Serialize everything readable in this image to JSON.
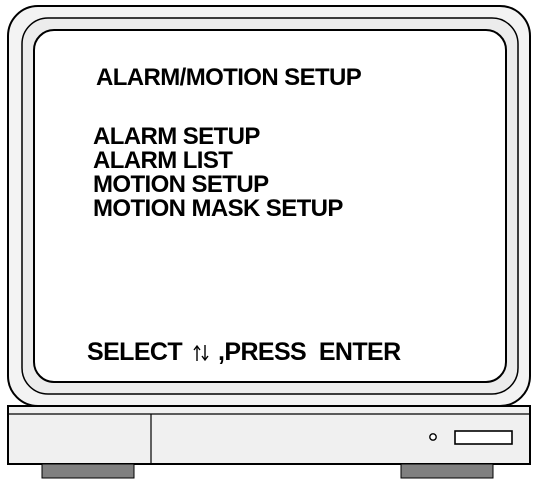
{
  "osd_menu": {
    "title": "ALARM/MOTION SETUP",
    "items": [
      {
        "label": "ALARM SETUP"
      },
      {
        "label": "ALARM LIST"
      },
      {
        "label": "MOTION SETUP"
      },
      {
        "label": "MOTION MASK SETUP"
      }
    ]
  },
  "footer": {
    "select_label": "SELECT",
    "arrow_icon": "up-down-arrows-icon",
    "press_label": ",PRESS  ENTER"
  },
  "colors": {
    "outline": "#000000",
    "screen": "#ffffff",
    "bezel": "#f0f0f0",
    "foot": "#808080"
  }
}
